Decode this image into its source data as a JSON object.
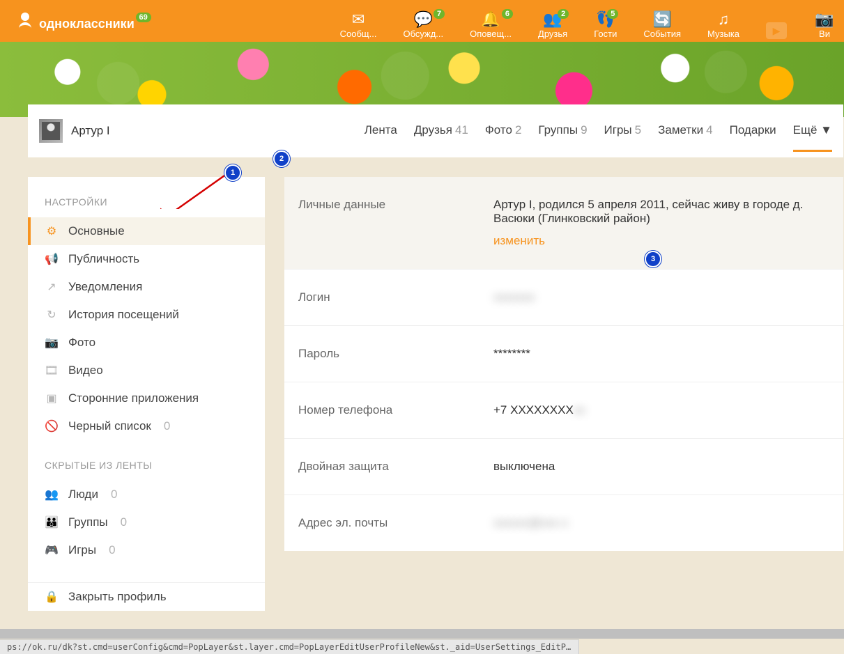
{
  "logo_text": "одноклассники",
  "logo_badge": "69",
  "topnav": [
    {
      "label": "Сообщ...",
      "icon": "✉",
      "badge": ""
    },
    {
      "label": "Обсужд...",
      "icon": "💬",
      "badge": "7"
    },
    {
      "label": "Оповещ...",
      "icon": "🔔",
      "badge": "6"
    },
    {
      "label": "Друзья",
      "icon": "👥",
      "badge": "2"
    },
    {
      "label": "Гости",
      "icon": "👣",
      "badge": "5"
    },
    {
      "label": "События",
      "icon": "🔄",
      "badge": ""
    },
    {
      "label": "Музыка",
      "icon": "♫",
      "badge": ""
    },
    {
      "label": "",
      "icon": "▶",
      "badge": ""
    },
    {
      "label": "Ви",
      "icon": "📷",
      "badge": ""
    }
  ],
  "profile_name": "Артур I",
  "tabs": [
    {
      "label": "Лента",
      "count": ""
    },
    {
      "label": "Друзья",
      "count": "41"
    },
    {
      "label": "Фото",
      "count": "2"
    },
    {
      "label": "Группы",
      "count": "9"
    },
    {
      "label": "Игры",
      "count": "5"
    },
    {
      "label": "Заметки",
      "count": "4"
    },
    {
      "label": "Подарки",
      "count": ""
    },
    {
      "label": "Ещё ▼",
      "count": ""
    }
  ],
  "sidebar": {
    "section1_title": "НАСТРОЙКИ",
    "items1": [
      {
        "label": "Основные",
        "icon": "⚙",
        "count": ""
      },
      {
        "label": "Публичность",
        "icon": "📢",
        "count": ""
      },
      {
        "label": "Уведомления",
        "icon": "↗",
        "count": ""
      },
      {
        "label": "История посещений",
        "icon": "↻",
        "count": ""
      },
      {
        "label": "Фото",
        "icon": "📷",
        "count": ""
      },
      {
        "label": "Видео",
        "icon": "🎞",
        "count": ""
      },
      {
        "label": "Сторонние приложения",
        "icon": "▣",
        "count": ""
      },
      {
        "label": "Черный список",
        "icon": "🚫",
        "count": "0"
      }
    ],
    "section2_title": "СКРЫТЫЕ ИЗ ЛЕНТЫ",
    "items2": [
      {
        "label": "Люди",
        "icon": "👥",
        "count": "0"
      },
      {
        "label": "Группы",
        "icon": "👪",
        "count": "0"
      },
      {
        "label": "Игры",
        "icon": "🎮",
        "count": "0"
      }
    ],
    "lock_label": "Закрыть профиль"
  },
  "settings": {
    "rows": [
      {
        "label": "Личные данные",
        "value": "Артур I, родился 5 апреля 2011, сейчас живу в городе д. Васюки (Глинковский район)",
        "edit": "изменить"
      },
      {
        "label": "Логин",
        "value_blurred": "xxxxxxx"
      },
      {
        "label": "Пароль",
        "value": "********"
      },
      {
        "label": "Номер телефона",
        "value": "+7 XXXXXXXX",
        "value_blurred_tail": "xx"
      },
      {
        "label": "Двойная защита",
        "value": "выключена"
      },
      {
        "label": "Адрес эл. почты",
        "value_blurred": "xxxxxx@xxx x"
      }
    ]
  },
  "status_url": "ps://ok.ru/dk?st.cmd=userConfig&cmd=PopLayer&st.layer.cmd=PopLayerEditUserProfileNew&st._aid=UserSettings_EditProfile",
  "markers": {
    "m1": "1",
    "m2": "2",
    "m3": "3"
  }
}
